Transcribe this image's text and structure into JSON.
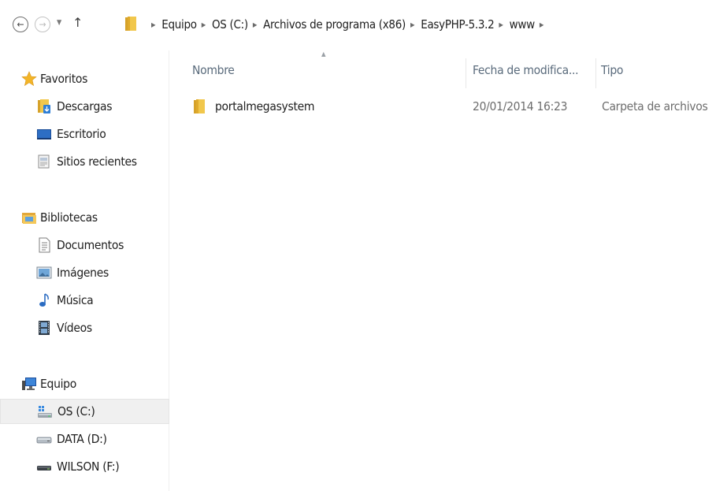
{
  "navigation": {
    "back_icon": "back-arrow-icon",
    "forward_icon": "forward-arrow-icon",
    "recent_icon": "chevron-down-icon",
    "up_icon": "up-arrow-icon",
    "back_glyph": "←",
    "forward_glyph": "→",
    "recent_glyph": "▼",
    "up_glyph": "↑",
    "separator_glyph": "▶",
    "breadcrumb": [
      "Equipo",
      "OS (C:)",
      "Archivos de programa (x86)",
      "EasyPHP-5.3.2",
      "www"
    ]
  },
  "sidebar": {
    "favorites": {
      "label": "Favoritos",
      "icon": "star-icon",
      "items": [
        {
          "label": "Descargas",
          "icon": "downloads-folder-icon"
        },
        {
          "label": "Escritorio",
          "icon": "desktop-icon"
        },
        {
          "label": "Sitios recientes",
          "icon": "recent-places-icon"
        }
      ]
    },
    "libraries": {
      "label": "Bibliotecas",
      "icon": "libraries-icon",
      "items": [
        {
          "label": "Documentos",
          "icon": "documents-icon"
        },
        {
          "label": "Imágenes",
          "icon": "pictures-icon"
        },
        {
          "label": "Música",
          "icon": "music-icon"
        },
        {
          "label": "Vídeos",
          "icon": "videos-icon"
        }
      ]
    },
    "computer": {
      "label": "Equipo",
      "icon": "computer-icon",
      "items": [
        {
          "label": "OS (C:)",
          "icon": "system-drive-icon",
          "selected": true
        },
        {
          "label": "DATA (D:)",
          "icon": "drive-icon"
        },
        {
          "label": "WILSON (F:)",
          "icon": "removable-drive-icon"
        }
      ]
    }
  },
  "content": {
    "columns": {
      "name": "Nombre",
      "date": "Fecha de modifica...",
      "type": "Tipo"
    },
    "sort_glyph": "▲",
    "rows": [
      {
        "name": "portalmegasystem",
        "date": "20/01/2014 16:23",
        "type": "Carpeta de archivos",
        "icon": "folder-icon"
      }
    ]
  },
  "colors": {
    "folder": "#e8b93a",
    "selection": "#f0f0f0",
    "header_text": "#5a6b7c",
    "star": "#f3b528"
  }
}
